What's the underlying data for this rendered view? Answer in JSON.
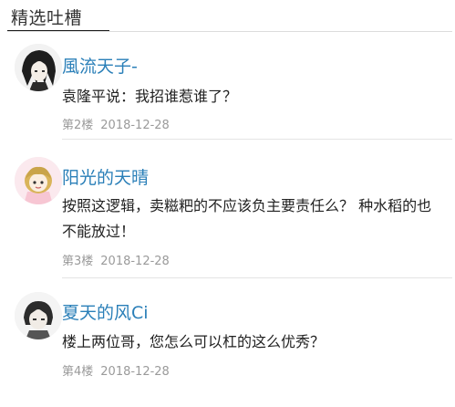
{
  "section": {
    "title": "精选吐槽"
  },
  "comments": [
    {
      "username": "風流天子-",
      "text": "袁隆平说：我招谁惹谁了？",
      "floor": "第2楼",
      "date": "2018-12-28",
      "avatar_icon": "dark-hair-character-avatar"
    },
    {
      "username": "阳光的天晴",
      "text": "按照这逻辑，卖糍粑的不应该负主要责任么？ 种水稻的也不能放过！",
      "floor": "第3楼",
      "date": "2018-12-28",
      "avatar_icon": "blonde-chibi-character-avatar"
    },
    {
      "username": "夏天的风Ci",
      "text": "楼上两位哥，您怎么可以杠的这么优秀？",
      "floor": "第4楼",
      "date": "2018-12-28",
      "avatar_icon": "sketch-character-avatar"
    }
  ],
  "colors": {
    "username": "#2a7fb8",
    "meta": "#9a9a9a",
    "divider": "#e4e4e4"
  }
}
